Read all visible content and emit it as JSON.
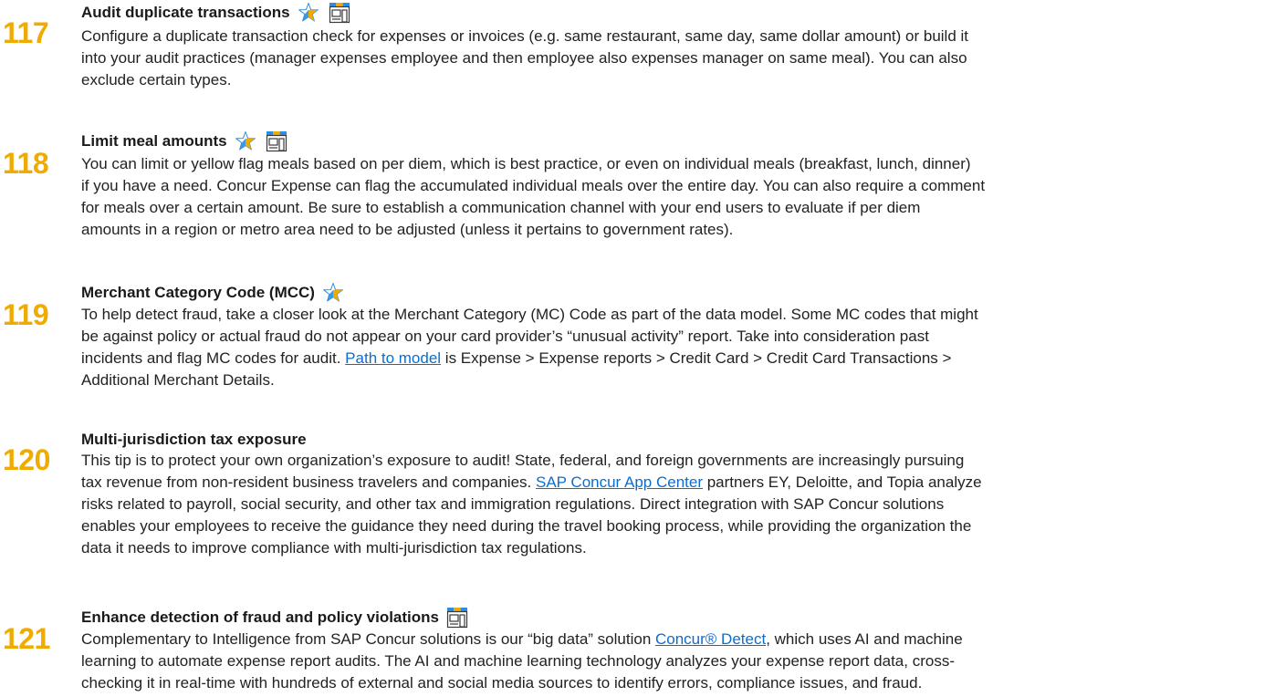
{
  "colors": {
    "number": "#f0ab00",
    "link": "#0a6ed1",
    "text": "#222222"
  },
  "icons": {
    "star": "star-icon",
    "store": "storefront-icon"
  },
  "tips": [
    {
      "number": "117",
      "title": "Audit duplicate transactions",
      "icons": [
        "star-icon",
        "storefront-icon"
      ],
      "lines": [
        "Configure a duplicate transaction check for expenses or invoices (e.g. same restaurant, same day, same dollar amount) or build it",
        "into your audit practices (manager expenses employee and then employee also expenses manager on same meal). You can also",
        "exclude certain types."
      ]
    },
    {
      "number": "118",
      "title": "Limit meal amounts",
      "icons": [
        "star-icon",
        "storefront-icon"
      ],
      "lines": [
        "You can limit or yellow flag meals based on per diem, which is best practice, or even on individual meals (breakfast, lunch, dinner)",
        "if you have a need. Concur Expense can flag the accumulated individual meals over the entire day. You can also require a comment",
        "for meals over a certain amount. Be sure to establish a communication channel with your end users to evaluate if per diem",
        "amounts in a region or metro area need to be adjusted (unless it pertains to government rates)."
      ]
    },
    {
      "number": "119",
      "title": "Merchant Category Code (MCC)",
      "icons": [
        "star-icon"
      ],
      "lines": [
        "To help detect fraud, take a closer look at the Merchant Category (MC) Code as part of the data model. Some MC codes that might",
        "be against policy or actual fraud do not appear on your card provider’s “unusual activity” report. Take into consideration past",
        "incidents and flag MC codes for audit."
      ],
      "line4_link": "Path to model",
      "line4_rest": " is Expense > Expense reports > Credit Card > Credit Card Transactions >",
      "line5": "Additional Merchant Details."
    },
    {
      "number": "120",
      "title": "Multi-jurisdiction tax exposure",
      "icons": [],
      "lines": [
        "This tip is to protect your own organization’s exposure to audit! State, federal, and foreign governments are increasingly pursuing"
      ],
      "line2_pre": "tax revenue from non-resident business travelers and companies. ",
      "line2_link": "SAP Concur App Center",
      "line2_post": " partners EY, Deloitte, and Topia analyze",
      "rest": [
        "risks related to payroll, social security, and other tax and immigration regulations. Direct integration with SAP Concur solutions",
        "enables your employees to receive the guidance they need during the travel booking process, while providing the organization the",
        "data it needs to improve compliance with multi-jurisdiction tax regulations."
      ]
    },
    {
      "number": "121",
      "title": "Enhance detection of fraud and policy violations",
      "icons": [
        "storefront-icon"
      ],
      "line1_pre": "Complementary to Intelligence from SAP Concur solutions is our “big data” solution ",
      "line1_link": "Concur® Detect",
      "line1_post": ", which uses AI and machine",
      "rest": [
        "learning to automate expense report audits. The AI and machine learning technology analyzes your expense report data, cross-",
        "checking it in real-time with hundreds of external and social media sources to identify errors, compliance issues, and fraud."
      ]
    }
  ]
}
